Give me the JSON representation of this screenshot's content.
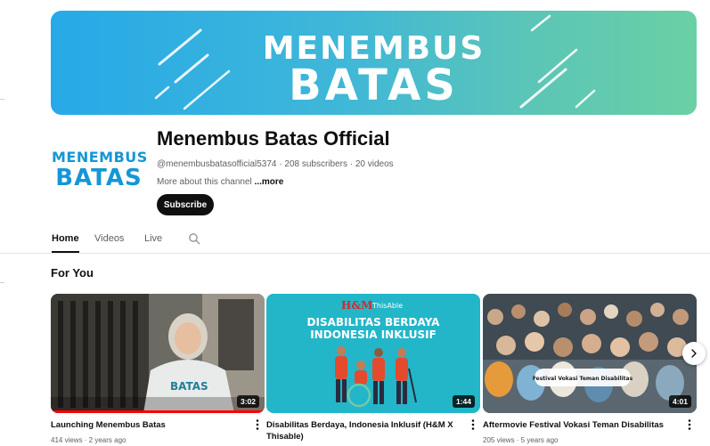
{
  "banner": {
    "line1": "MENEMBUS",
    "line2": "BATAS",
    "colors": {
      "start": "#27a9e8",
      "end": "#6ad0a4",
      "text": "#ffffff"
    }
  },
  "avatar": {
    "line1": "MENEMBUS",
    "line2": "BATAS",
    "color": "#1596d6"
  },
  "channel": {
    "name": "Menembus Batas Official",
    "meta": "@menembusbatasofficial5374 · 208 subscribers · 20 videos",
    "about": "More about this channel ",
    "about_more": "...more",
    "subscribe_label": "Subscribe"
  },
  "tabs": [
    {
      "label": "Home",
      "active": true
    },
    {
      "label": "Videos",
      "active": false
    },
    {
      "label": "Live",
      "active": false
    }
  ],
  "section": {
    "title": "For You"
  },
  "videos": [
    {
      "title": "Launching Menembus Batas",
      "meta": "414 views · 2 years ago",
      "duration": "3:02",
      "thumb_caption": ""
    },
    {
      "title": "Disabilitas Berdaya, Indonesia Inklusif (H&M X Thisable)",
      "meta": "",
      "duration": "1:44",
      "thumb_brand": "H&M",
      "thumb_brand2": "ThisAble",
      "thumb_line1": "DISABILITAS BERDAYA",
      "thumb_line2": "INDONESIA INKLUSIF"
    },
    {
      "title": "Aftermovie Festival Vokasi Teman Disabilitas",
      "meta": "205 views · 5 years ago",
      "duration": "4:01",
      "thumb_caption": "Festival Vokasi Teman Disabilitas"
    }
  ],
  "icons": {
    "search": "search-icon",
    "more": "more-vert-icon",
    "next": "chevron-right-icon"
  }
}
